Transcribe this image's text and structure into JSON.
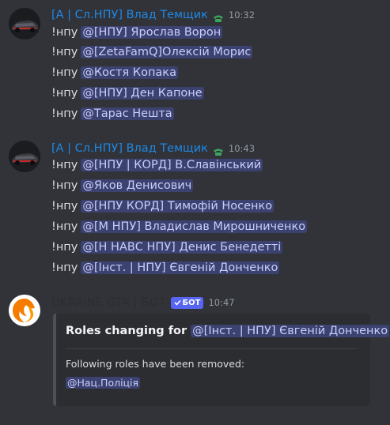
{
  "messages": [
    {
      "username": "[А | Сл.НПУ] Влад Темщик",
      "timestamp": "10:32",
      "lines": [
        {
          "cmd": "!нпу",
          "mention": "@[НПУ] Ярослав Ворон"
        },
        {
          "cmd": "!нпу",
          "mention": "@[ZetaFamQ]Олексій Морис"
        },
        {
          "cmd": "!нпу",
          "mention": "@Костя Копака"
        },
        {
          "cmd": "!нпу",
          "mention": "@[НПУ] Ден Капоне"
        },
        {
          "cmd": "!нпу",
          "mention": "@Тарас Нешта"
        }
      ]
    },
    {
      "username": "[А | Сл.НПУ] Влад Темщик",
      "timestamp": "10:43",
      "lines": [
        {
          "cmd": "!нпу",
          "mention": "@[НПУ | КОРД] В.Славінський"
        },
        {
          "cmd": "!нпу",
          "mention": "@Яков Денисович"
        },
        {
          "cmd": "!нпу",
          "mention": "@[НПУ КОРД] Тимофій Носенко"
        },
        {
          "cmd": "!нпу",
          "mention": "@[М НПУ] Владислав Мирошниченко"
        },
        {
          "cmd": "!нпу",
          "mention": "@[Н НАВС НПУ] Денис Бенедетті"
        },
        {
          "cmd": "!нпу",
          "mention": "@[Інст. | НПУ] Євгеній Донченко"
        }
      ]
    }
  ],
  "bot_message": {
    "username": "UKRAINE GTA | БОТ",
    "tag": "БОТ",
    "timestamp": "10:47",
    "embed": {
      "title": "Roles changing for",
      "title_mention": "@[Інст. | НПУ] Євгеній Донченко",
      "description": "Following roles have been removed:",
      "role_mention": "@Нац.Поліція"
    }
  },
  "colors": {
    "background": "#313338",
    "username": "#1e88e5",
    "mention_bg": "#3c4270",
    "mention_text": "#c9cdfb",
    "bot_tag": "#5865f2",
    "embed_bg": "#2b2d31"
  },
  "icons": {
    "role_icon": "telephone-icon",
    "bot_avatar": "fox-logo-icon"
  }
}
